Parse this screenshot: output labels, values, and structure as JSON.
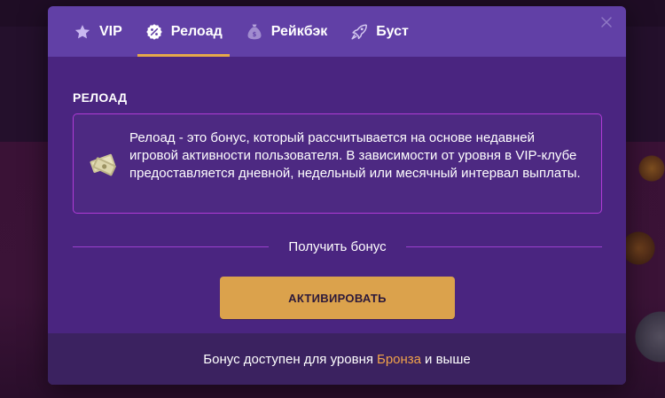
{
  "colors": {
    "modal_bg": "#4a2580",
    "tabs_bg": "#6140a6",
    "footer_bg": "#3b2260",
    "accent_orange": "#dba24c",
    "tier_color": "#f0a24a",
    "border_purple": "#b03bd6"
  },
  "tabs": [
    {
      "label": "VIP",
      "icon": "star-icon",
      "active": false
    },
    {
      "label": "Релоад",
      "icon": "percent-badge-icon",
      "active": true
    },
    {
      "label": "Рейкбэк",
      "icon": "money-bag-icon",
      "active": false
    },
    {
      "label": "Буст",
      "icon": "rocket-icon",
      "active": false
    }
  ],
  "close_icon": "close-icon",
  "section": {
    "title": "РЕЛОАД",
    "icon": "money-stack-icon",
    "description": "Релоад - это бонус, который рассчитывается на основе недавней игровой активности пользователя. В зависимости от уровня в VIP-клубе предоставляется дневной, недельный или месячный интервал выплаты."
  },
  "bonus": {
    "divider_label": "Получить бонус",
    "activate_label": "АКТИВИРОВАТЬ"
  },
  "footer": {
    "prefix": "Бонус доступен для уровня",
    "tier": "Бронза",
    "suffix": "и выше"
  }
}
